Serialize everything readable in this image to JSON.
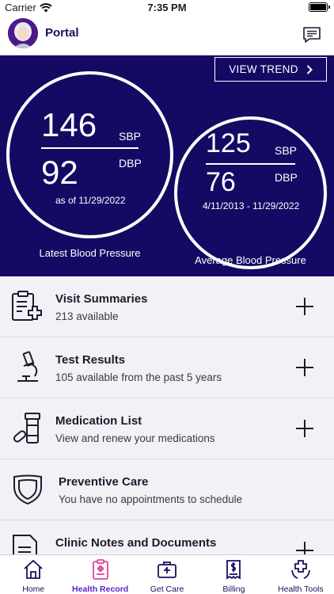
{
  "status_bar": {
    "carrier": "Carrier",
    "time": "7:35 PM"
  },
  "header": {
    "title": "Portal"
  },
  "blood_pressure": {
    "view_trend_label": "VIEW TREND",
    "latest": {
      "sbp": "146",
      "dbp": "92",
      "sbp_unit": "SBP",
      "dbp_unit": "DBP",
      "date_text": "as of 11/29/2022",
      "label": "Latest Blood Pressure"
    },
    "average": {
      "sbp": "125",
      "dbp": "76",
      "sbp_unit": "SBP",
      "dbp_unit": "DBP",
      "range_text": "4/11/2013 - 11/29/2022",
      "label": "Average Blood Pressure"
    }
  },
  "records": [
    {
      "title": "Visit Summaries",
      "subtitle": "213 available",
      "icon": "clipboard-plus-icon"
    },
    {
      "title": "Test Results",
      "subtitle": "105 available from the past 5 years",
      "icon": "microscope-icon"
    },
    {
      "title": "Medication List",
      "subtitle": "View and renew your medications",
      "icon": "pill-bottle-icon"
    },
    {
      "title": "Preventive Care",
      "subtitle": "You have no appointments to schedule",
      "icon": "shield-icon"
    },
    {
      "title": "Clinic Notes and Documents",
      "subtitle": "",
      "icon": "document-icon"
    }
  ],
  "tabs": [
    {
      "label": "Home",
      "icon": "home-icon",
      "active": false
    },
    {
      "label": "Health Record",
      "icon": "health-record-icon",
      "active": true
    },
    {
      "label": "Get Care",
      "icon": "medical-bag-icon",
      "active": false
    },
    {
      "label": "Billing",
      "icon": "bill-icon",
      "active": false
    },
    {
      "label": "Health Tools",
      "icon": "hands-cross-icon",
      "active": false
    }
  ],
  "colors": {
    "brand_dark": "#150a63",
    "accent": "#5a24c9",
    "tab_active_icon": "#e0449a"
  }
}
